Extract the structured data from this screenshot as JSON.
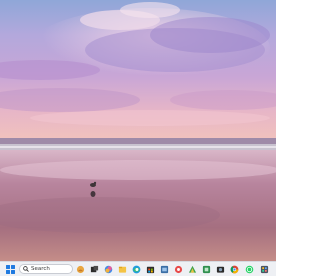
{
  "taskbar": {
    "search_placeholder": "Search",
    "icons": [
      "start-icon",
      "search-icon",
      "widget-icon",
      "task-view-icon",
      "copilot-icon",
      "file-explorer-icon",
      "edge-icon",
      "store-icon",
      "terminal-icon",
      "photos-icon",
      "red-app-icon",
      "maps-icon",
      "camera-app-icon",
      "chrome-icon",
      "whatsapp-icon",
      "office-icon"
    ]
  },
  "colors": {
    "accent": "#1f7ae0",
    "taskbar_bg": "#eef0f4"
  }
}
